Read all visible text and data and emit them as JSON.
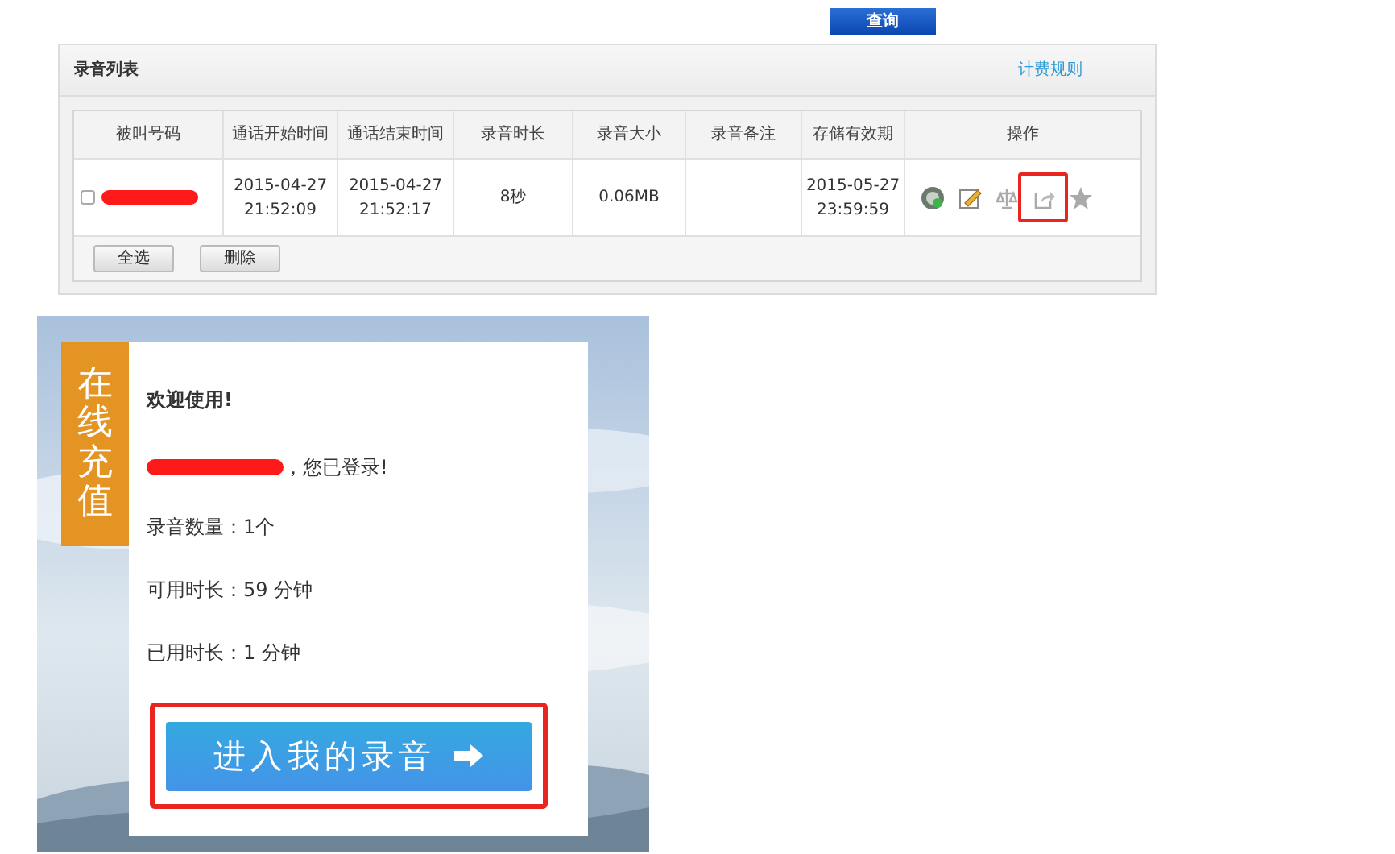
{
  "query_button": "查询",
  "recording_list": {
    "title": "录音列表",
    "billing_link": "计费规则",
    "columns": [
      "被叫号码",
      "通话开始时间",
      "通话结束时间",
      "录音时长",
      "录音大小",
      "录音备注",
      "存储有效期",
      "操作"
    ],
    "rows": [
      {
        "checked": false,
        "start_date": "2015-04-27",
        "start_time": "21:52:09",
        "end_date": "2015-04-27",
        "end_time": "21:52:17",
        "duration": "8秒",
        "size": "0.06MB",
        "expiry_date": "2015-05-27",
        "expiry_time": "23:59:59",
        "actions": [
          {
            "kind": "play",
            "highlighted": false
          },
          {
            "kind": "edit",
            "highlighted": false
          },
          {
            "kind": "scale",
            "highlighted": false
          },
          {
            "kind": "share",
            "highlighted": true
          },
          {
            "kind": "star",
            "highlighted": false
          }
        ]
      }
    ],
    "buttons": [
      "全选",
      "删除"
    ]
  },
  "recharge_tab": "在线充值",
  "account_card": {
    "welcome": "欢迎使用!",
    "login_suffix": "，您已登录!",
    "stats": [
      "录音数量：1个",
      "可用时长：59 分钟",
      "已用时长：1 分钟"
    ],
    "enter_button": {
      "label": "进入我的录音",
      "highlighted": true
    }
  }
}
